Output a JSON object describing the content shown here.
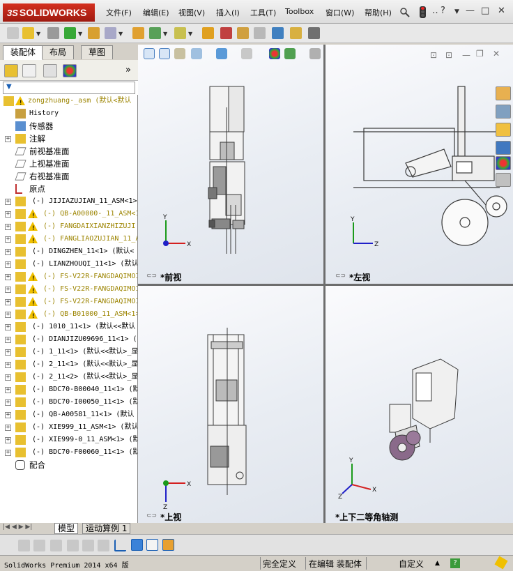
{
  "app": {
    "logo_text": "SOLIDWORKS",
    "menu": [
      "文件(F)",
      "编辑(E)",
      "视图(V)",
      "插入(I)",
      "工具(T)",
      "Toolbox",
      "窗口(W)",
      "帮助(H)"
    ],
    "window_controls": {
      "help": "?",
      "minimize": "—",
      "restore": "□",
      "close": "✕",
      "more": "‥"
    }
  },
  "left_panel": {
    "tabs": [
      "装配体",
      "布局",
      "草图"
    ],
    "expand_glyph": "»",
    "filter_glyph": "▼"
  },
  "tree": {
    "root": "zongzhuang-_asm  (默认<默认",
    "items": [
      {
        "label": "History",
        "expand": false,
        "warn": false,
        "kind": "history",
        "cn": false
      },
      {
        "label": "传感器",
        "expand": false,
        "warn": false,
        "kind": "sensor",
        "cn": true
      },
      {
        "label": "注解",
        "expand": true,
        "warn": false,
        "kind": "annotation",
        "cn": true
      },
      {
        "label": "前视基准面",
        "expand": false,
        "warn": false,
        "kind": "plane",
        "cn": true
      },
      {
        "label": "上视基准面",
        "expand": false,
        "warn": false,
        "kind": "plane",
        "cn": true
      },
      {
        "label": "右视基准面",
        "expand": false,
        "warn": false,
        "kind": "plane",
        "cn": true
      },
      {
        "label": "原点",
        "expand": false,
        "warn": false,
        "kind": "origin",
        "cn": true
      },
      {
        "label": "(-) JIJIAZUJIAN_11_ASM<1>",
        "expand": true,
        "warn": false,
        "kind": "asm",
        "cn": false
      },
      {
        "label": "(-) QB-A00000-_11_ASM<1",
        "expand": true,
        "warn": true,
        "kind": "asm",
        "cn": false
      },
      {
        "label": "(-) FANGDAIXIANZHIZUJI",
        "expand": true,
        "warn": true,
        "kind": "asm",
        "cn": false
      },
      {
        "label": "(-) FANGLIAOZUJIAN_11_A",
        "expand": true,
        "warn": true,
        "kind": "asm",
        "cn": false
      },
      {
        "label": "(-) DINGZHEN_11<1>  (默认<",
        "expand": true,
        "warn": false,
        "kind": "part",
        "cn": false
      },
      {
        "label": "(-) LIANZHOUQI_11<1>  (默认",
        "expand": true,
        "warn": false,
        "kind": "part",
        "cn": false
      },
      {
        "label": "(-) FS-V22R-FANGDAQIMOI",
        "expand": true,
        "warn": true,
        "kind": "part",
        "cn": false
      },
      {
        "label": "(-) FS-V22R-FANGDAQIMOI",
        "expand": true,
        "warn": true,
        "kind": "part",
        "cn": false
      },
      {
        "label": "(-) FS-V22R-FANGDAQIMOI",
        "expand": true,
        "warn": true,
        "kind": "part",
        "cn": false
      },
      {
        "label": "(-) QB-B01000_11_ASM<1>",
        "expand": true,
        "warn": true,
        "kind": "asm",
        "cn": false
      },
      {
        "label": "(-) 1010_11<1>  (默认<<默认",
        "expand": true,
        "warn": false,
        "kind": "part",
        "cn": false
      },
      {
        "label": "(-) DIANJIZU09696_11<1>  (",
        "expand": true,
        "warn": false,
        "kind": "part",
        "cn": false
      },
      {
        "label": "(-) 1_11<1>  (默认<<默认>_显",
        "expand": true,
        "warn": false,
        "kind": "part",
        "cn": false
      },
      {
        "label": "(-) 2_11<1>  (默认<<默认>_显",
        "expand": true,
        "warn": false,
        "kind": "part",
        "cn": false
      },
      {
        "label": "(-) 2_11<2>  (默认<<默认>_显",
        "expand": true,
        "warn": false,
        "kind": "part",
        "cn": false
      },
      {
        "label": "(-) BDC70-B00040_11<1>  (默",
        "expand": true,
        "warn": false,
        "kind": "part",
        "cn": false
      },
      {
        "label": "(-) BDC70-I00050_11<1>  (默",
        "expand": true,
        "warn": false,
        "kind": "part",
        "cn": false
      },
      {
        "label": "(-) QB-A00581_11<1>  (默认",
        "expand": true,
        "warn": false,
        "kind": "part",
        "cn": false
      },
      {
        "label": "(-) XIE999_11_ASM<1>  (默认",
        "expand": true,
        "warn": false,
        "kind": "asm",
        "cn": false
      },
      {
        "label": "(-) XIE999-0_11_ASM<1>  (默",
        "expand": true,
        "warn": false,
        "kind": "asm",
        "cn": false
      },
      {
        "label": "(-) BDC70-F00060_11<1>  (默",
        "expand": true,
        "warn": false,
        "kind": "part",
        "cn": false
      },
      {
        "label": "配合",
        "expand": false,
        "warn": false,
        "kind": "mates",
        "cn": true
      }
    ]
  },
  "viewports": [
    {
      "label": "*前视",
      "axes": [
        "Y",
        "X"
      ]
    },
    {
      "label": "*左视",
      "axes": [
        "Y",
        "Z"
      ]
    },
    {
      "label": "*上视",
      "axes": [
        "X",
        "Z"
      ]
    },
    {
      "label": "*上下二等角轴测",
      "axes": [
        "Y",
        "X",
        "Z"
      ]
    }
  ],
  "bottom_tabs": [
    "模型",
    "运动算例 1"
  ],
  "status": {
    "version": "SolidWorks Premium 2014 x64 版",
    "state": "完全定义",
    "mode": "在编辑 装配体",
    "units": "自定义",
    "up": "▲",
    "help": "?"
  },
  "colors": {
    "brand_red": "#c0281a",
    "warning_yellow": "#f0c000",
    "axis_x": "#d42020",
    "axis_y": "#1a9a1a",
    "axis_z": "#2020c8"
  }
}
